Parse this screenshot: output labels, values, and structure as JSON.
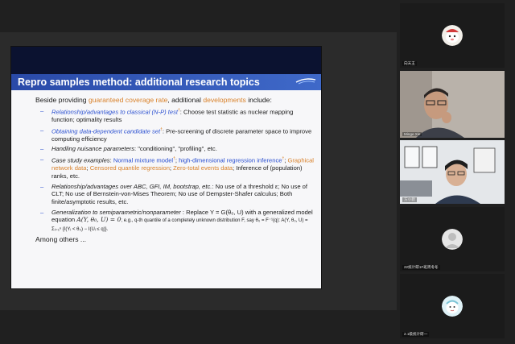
{
  "slide": {
    "title": "Repro samples method: additional research topics",
    "intro": {
      "prefix": "Beside providing ",
      "highlight1": "guaranteed coverage rate",
      "middle": ", additional ",
      "highlight2": "developments",
      "suffix": " include:"
    },
    "bullets": {
      "b1": {
        "lead": "Relationship/advantages to classical (N-P) test",
        "sup": "†",
        "rest": ": Choose test statistic as nuclear mapping function; optimality results"
      },
      "b2": {
        "lead": "Obtaining data-dependent candidate set",
        "sup": "†",
        "rest": ": Pre-screening of discrete parameter space to improve computing efficiency"
      },
      "b3": {
        "lead": "Handling nuisance parameters",
        "rest": ": \"conditioning\", \"profiling\", etc."
      },
      "b4": {
        "lead": "Case study examples",
        "c1": "Normal mixture model",
        "sup": "†",
        "c2": "high-dimensional regression inference",
        "sup2": "†",
        "c3": "Graphical network data",
        "c4": "Censored quantile regression",
        "c5": "Zero-total events data",
        "c6": "Inference of (population) ranks, etc."
      },
      "b5": {
        "lead": "Relationship/advantages over ABC, GFI, IM, bootstrap, etc.",
        "rest": ": No use of a threshold ε; No use of CLT; No use of Bernstein-von-Mises Theorem; No use of Dempster-Shafer calculus; Both finite/asymptotic results, etc."
      },
      "b6": {
        "lead": "Generalization to semiparametric/nonparameter",
        "rest1": " : Replace Y = G(θ₀, U) with a generalized model equation ",
        "eq": "A(Y, θ₀, U) = 0",
        "rest2": "; e.g., q-th quantile of a completely unknown distribution F, say θ₀ = F⁻¹(q): A(Y, θ₀, U) = Σᵢ₌₁ⁿ {I(Yᵢ < θ₀) − I(Uᵢ ≤ q)}."
      }
    },
    "tail": "Among others ..."
  },
  "participants": {
    "p1": "向天王",
    "p2": "Minge Xie",
    "p3": "方小教",
    "p4": "22统计研1F班周冬冬",
    "p5": "2.1级统计研一"
  },
  "colors": {
    "accent_orange": "#d9822b",
    "accent_blue": "#2a4fd0",
    "title_bar": "#2f56b6"
  }
}
